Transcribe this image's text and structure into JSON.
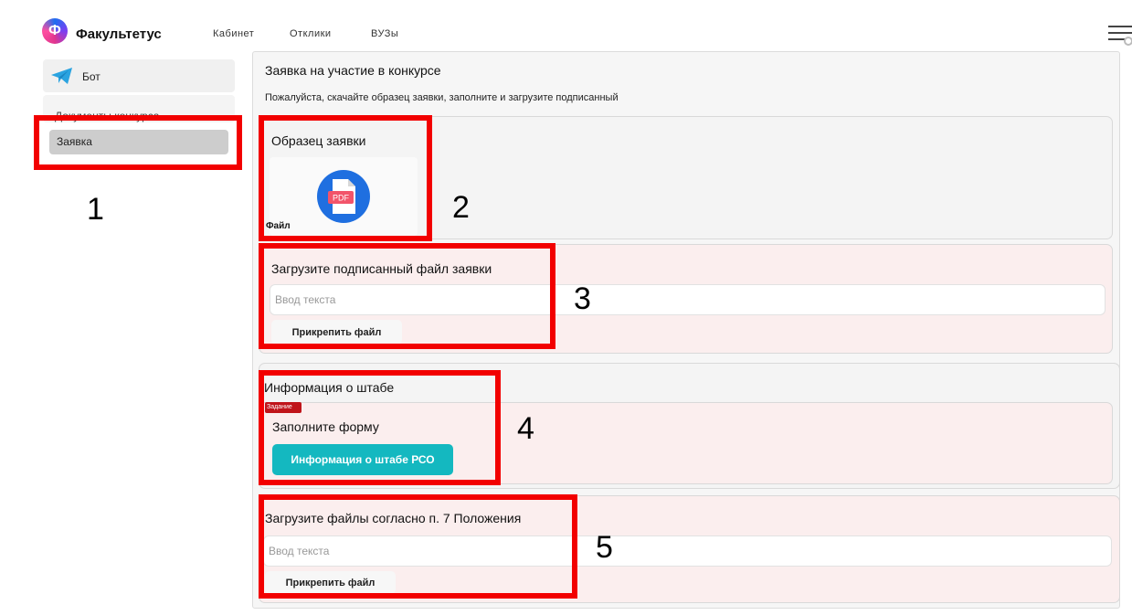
{
  "header": {
    "brand": "Факультетус",
    "logo_letter": "Ф",
    "nav": [
      "Кабинет",
      "Отклики",
      "ВУЗы"
    ]
  },
  "sidebar": {
    "items": [
      {
        "label": "Бот",
        "icon": "telegram-icon"
      },
      {
        "label": "Документы конкурса"
      },
      {
        "label": "Заявка",
        "selected": true
      }
    ]
  },
  "main": {
    "title": "Заявка на участие в конкурсе",
    "subtitle": "Пожалуйста, скачайте образец заявки, заполните и загрузите подписанный",
    "sample": {
      "heading": "Образец заявки",
      "file_label": "Файл",
      "file_icon_text": "PDF"
    },
    "upload_signed": {
      "heading": "Загрузите подписанный файл заявки",
      "placeholder": "Ввод текста",
      "button": "Прикрепить файл"
    },
    "hq_info": {
      "heading": "Информация о штабе",
      "badge": "Задание",
      "task_heading": "Заполните форму",
      "button": "Информация о штабе РСО"
    },
    "upload_files": {
      "heading": "Загрузите файлы согласно п. 7 Положения",
      "placeholder": "Ввод текста",
      "button": "Прикрепить файл"
    }
  },
  "annotations": [
    "1",
    "2",
    "3",
    "4",
    "5"
  ],
  "colors": {
    "annotation_red": "#f20000",
    "accent_teal": "#14b8c0",
    "badge_red": "#c0141a"
  }
}
